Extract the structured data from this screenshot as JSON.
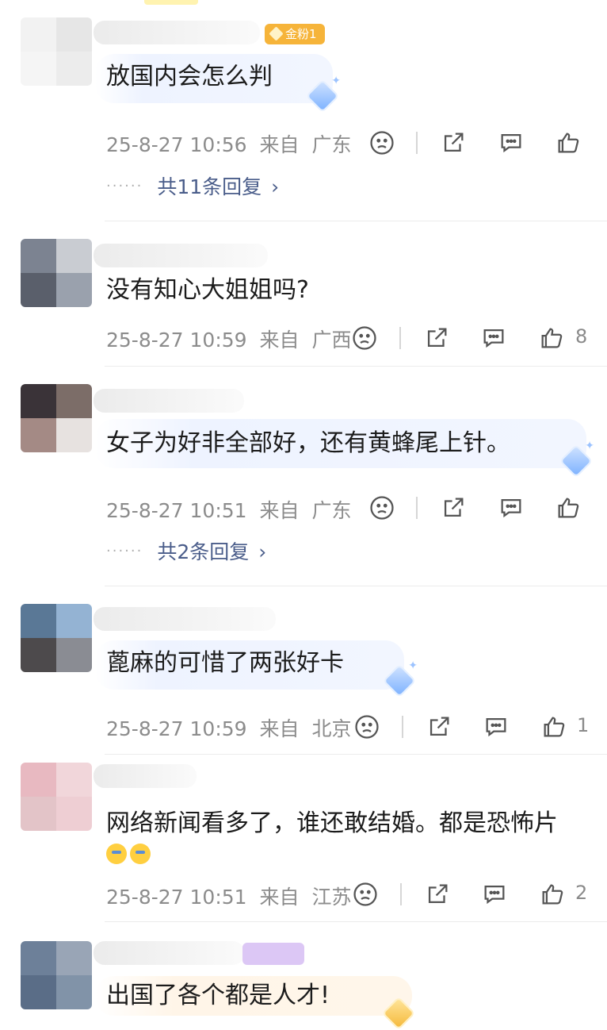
{
  "comments": [
    {
      "text": "放国内会怎么判",
      "badge": "金粉1",
      "date": "25-8-27 10:56",
      "from": "来自",
      "location": "广东",
      "like_count": "",
      "replies_label": "共11条回复",
      "avatar_colors": [
        "#f2f2f2",
        "#e6e6e6",
        "#f5f5f5",
        "#ececec"
      ]
    },
    {
      "text": "没有知心大姐姐吗?",
      "date": "25-8-27 10:59",
      "from": "来自",
      "location": "广西",
      "like_count": "8",
      "avatar_colors": [
        "#7c8391",
        "#c9ccd2",
        "#5a5f6b",
        "#9aa1ad"
      ]
    },
    {
      "text": "女子为好非全部好，还有黄蜂尾上针。",
      "date": "25-8-27 10:51",
      "from": "来自",
      "location": "广东",
      "like_count": "",
      "replies_label": "共2条回复",
      "avatar_colors": [
        "#3a3338",
        "#7c6d68",
        "#a48a85",
        "#e7e2e0"
      ]
    },
    {
      "text": "蓖麻的可惜了两张好卡",
      "date": "25-8-27 10:59",
      "from": "来自",
      "location": "北京",
      "like_count": "1",
      "avatar_colors": [
        "#5a7896",
        "#94b3d3",
        "#4d4a4c",
        "#8a8c93"
      ]
    },
    {
      "text": "网络新闻看多了，谁还敢结婚。都是恐怖片",
      "date": "25-8-27 10:51",
      "from": "来自",
      "location": "江苏",
      "like_count": "2",
      "avatar_colors": [
        "#e8b9c1",
        "#f1d6da",
        "#e3c4c8",
        "#eeced3"
      ]
    },
    {
      "text": "出国了各个都是人才!",
      "avatar_colors": [
        "#6d8099",
        "#99a5b6",
        "#5a6d87",
        "#8193a8"
      ]
    }
  ],
  "icons": {
    "dislike": "frown-face-icon",
    "share": "share-icon",
    "comment": "comment-icon",
    "like": "thumbs-up-icon",
    "decoration": "diamond-sticker-icon",
    "emoji": "crying-emoji-icon"
  },
  "colors": {
    "reply_link": "#4a5d8a",
    "meta": "#8c8c8c",
    "badge": "#f6b43a",
    "bubble": "#eef3ff"
  }
}
